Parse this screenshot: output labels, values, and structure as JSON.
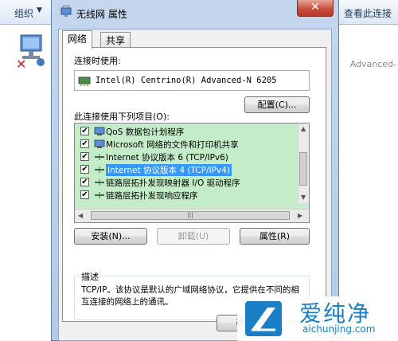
{
  "background_window": {
    "organize_label": "组织",
    "view_status_label": "查看此连接",
    "adapter_suffix": "Advanced-"
  },
  "dialog": {
    "title": "无线网 属性",
    "close_glyph": "✕",
    "tabs": [
      {
        "label": "网络",
        "active": true
      },
      {
        "label": "共享",
        "active": false
      }
    ],
    "connect_using_label": "连接时使用:",
    "adapter_name": "Intel(R) Centrino(R) Advanced-N 6205",
    "configure_button": "配置(C)...",
    "items_label": "此连接使用下列项目(O):",
    "items": [
      {
        "label": "QoS 数据包计划程序",
        "checked": true,
        "icon": "qos-icon",
        "selected": false
      },
      {
        "label": "Microsoft 网络的文件和打印机共享",
        "checked": true,
        "icon": "share-icon",
        "selected": false
      },
      {
        "label": "Internet 协议版本 6 (TCP/IPv6)",
        "checked": true,
        "icon": "protocol-icon",
        "selected": false
      },
      {
        "label": "Internet 协议版本 4 (TCP/IPv4)",
        "checked": true,
        "icon": "protocol-icon",
        "selected": true
      },
      {
        "label": "链路层拓扑发现映射器 I/O 驱动程序",
        "checked": true,
        "icon": "protocol-icon",
        "selected": false
      },
      {
        "label": "链路层拓扑发现响应程序",
        "checked": true,
        "icon": "protocol-icon",
        "selected": false
      }
    ],
    "install_button": "安装(N)...",
    "uninstall_button": "卸载(U)",
    "properties_button": "属性(R)",
    "description_title": "描述",
    "description_text": "TCP/IP。该协议是默认的广域网络协议，它提供在不同的相互连接的网络上的通讯。",
    "ok_button": "确"
  },
  "watermark": {
    "title": "爱纯净",
    "url": "aichunjing.com"
  },
  "colors": {
    "selection": "#3399ff",
    "list_background": "#c4ecc8",
    "close_button": "#c7503b",
    "watermark": "#1a7fc7"
  }
}
